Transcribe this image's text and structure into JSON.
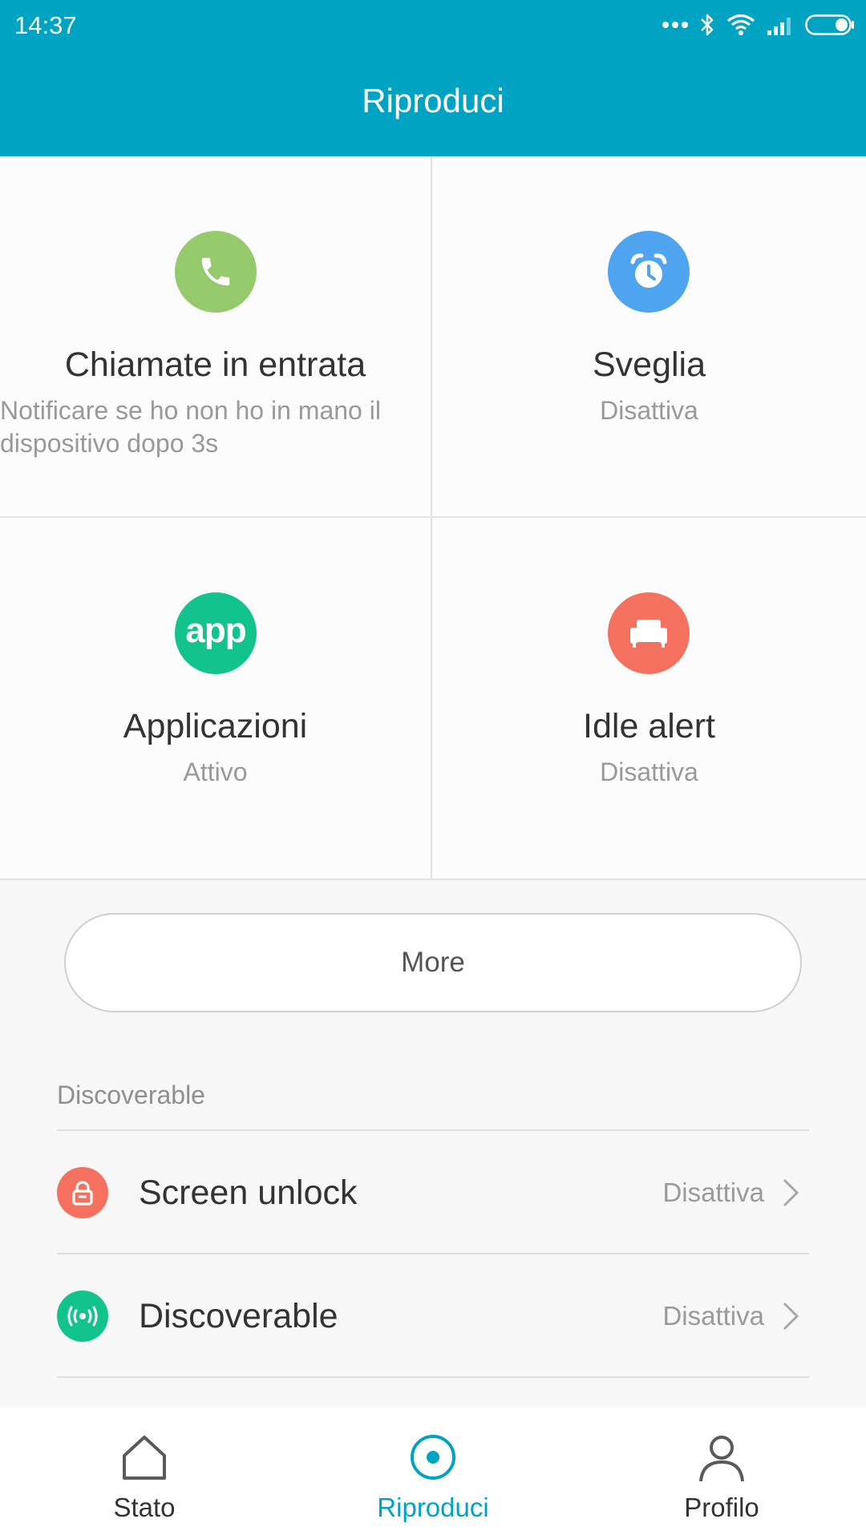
{
  "status_bar": {
    "time": "14:37"
  },
  "header": {
    "title": "Riproduci"
  },
  "tiles": [
    {
      "title": "Chiamate in entrata",
      "subtitle": "Notificare se ho non ho in mano il dispositivo dopo 3s",
      "icon": "phone-icon",
      "color": "#94c96c"
    },
    {
      "title": "Sveglia",
      "subtitle": "Disattiva",
      "icon": "alarm-clock-icon",
      "color": "#4ea4ef"
    },
    {
      "title": "Applicazioni",
      "subtitle": "Attivo",
      "icon": "app-icon",
      "icon_text": "app",
      "color": "#13c38e"
    },
    {
      "title": "Idle alert",
      "subtitle": "Disattiva",
      "icon": "sofa-icon",
      "color": "#f4715f"
    }
  ],
  "more_button": {
    "label": "More"
  },
  "section": {
    "label": "Discoverable",
    "rows": [
      {
        "label": "Screen unlock",
        "value": "Disattiva",
        "icon": "lock-icon",
        "color": "#f4715f"
      },
      {
        "label": "Discoverable",
        "value": "Disattiva",
        "icon": "broadcast-icon",
        "color": "#13c38e"
      }
    ]
  },
  "bottom_nav": {
    "items": [
      {
        "label": "Stato",
        "icon": "home-icon"
      },
      {
        "label": "Riproduci",
        "icon": "play-target-icon",
        "active": true
      },
      {
        "label": "Profilo",
        "icon": "person-icon"
      }
    ],
    "active_color": "#00a3c2"
  },
  "colors": {
    "accent": "#00a3c2",
    "background": "#f7f7f7"
  }
}
